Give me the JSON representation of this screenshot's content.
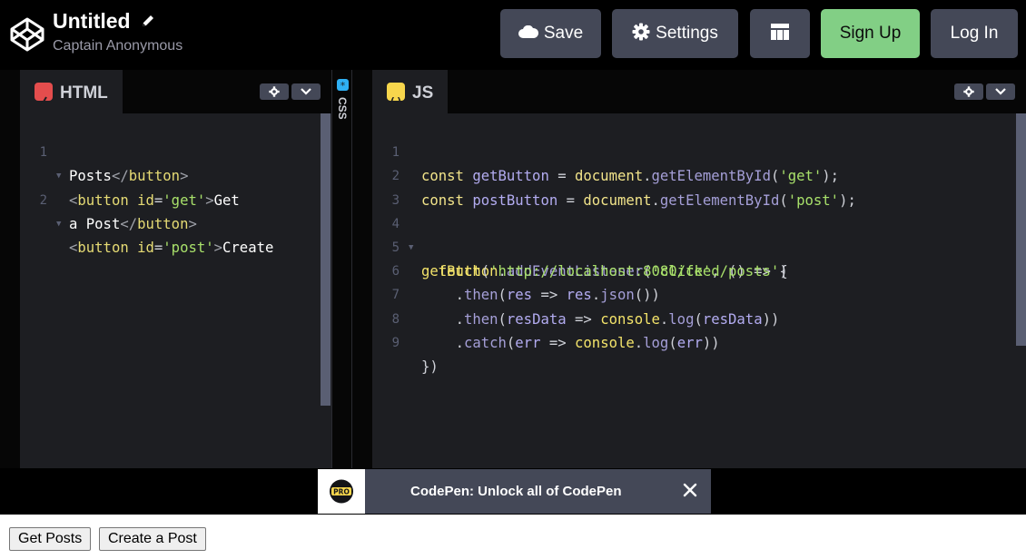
{
  "header": {
    "title": "Untitled",
    "author": "Captain Anonymous",
    "buttons": {
      "save": "Save",
      "settings": "Settings",
      "signup": "Sign Up",
      "login": "Log In"
    },
    "icons": [
      "codepen-logo-icon",
      "pencil-icon",
      "cloud-icon",
      "gear-icon",
      "layout-grid-icon"
    ]
  },
  "html_pane": {
    "tab_label": "HTML",
    "badge_color": "#e44d4d",
    "line_numbers": [
      "1",
      "2"
    ],
    "lines": [
      [
        "<button id='get'>Get",
        "Posts</button>"
      ],
      [
        "<button id='post'>Create",
        "a Post</button>"
      ]
    ]
  },
  "css_pane": {
    "tab_label": "CSS",
    "badge_color": "#2fb0f4"
  },
  "js_pane": {
    "tab_label": "JS",
    "badge_color": "#f7d64c",
    "line_numbers": [
      "1",
      "2",
      "3",
      "4",
      "5",
      "6",
      "7",
      "8",
      "9"
    ],
    "lines": [
      "const getButton = document.getElementById('get');",
      "const postButton = document.getElementById('post');",
      "",
      "getButton.addEventListener('click', () => {",
      "  fetch('http://localhost:8080/feed/posts')",
      "    .then(res => res.json())",
      "    .then(resData => console.log(resData))",
      "    .catch(err => console.log(err))",
      "})"
    ]
  },
  "promo": {
    "text": "CodePen: Unlock all of CodePen",
    "badge": "PRO"
  },
  "preview": {
    "get_button": "Get Posts",
    "post_button": "Create a Post"
  },
  "colors": {
    "accent_signup": "#82cf85",
    "button_bg": "#444857",
    "editor_bg": "#1d1e22"
  }
}
